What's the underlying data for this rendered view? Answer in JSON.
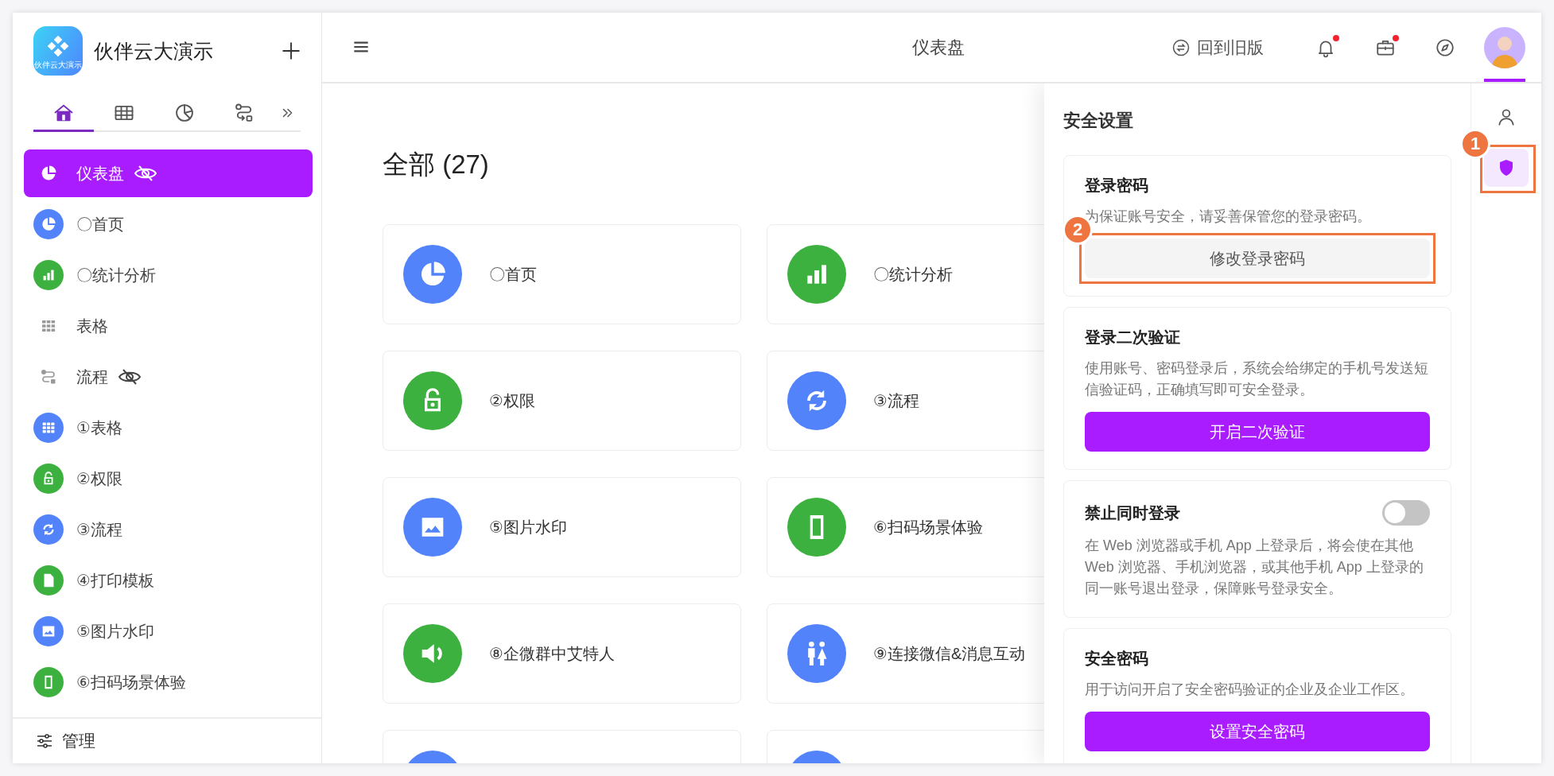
{
  "app": {
    "name": "伙伴云大演示",
    "logo_text": "伙伴云大演示"
  },
  "nav_tabs": [
    {
      "selected": true
    },
    {
      "selected": false
    },
    {
      "selected": false
    },
    {
      "selected": false
    },
    {
      "selected": false
    }
  ],
  "sidebar": {
    "items": [
      {
        "label": "仪表盘",
        "kind": "plain",
        "selected": true,
        "hidden": true
      },
      {
        "label": "〇首页",
        "kind": "app",
        "color": "#5283fb",
        "selected": false,
        "hidden": false
      },
      {
        "label": "〇统计分析",
        "kind": "app",
        "color": "#3db13f",
        "selected": false,
        "hidden": false
      },
      {
        "label": "表格",
        "kind": "plain",
        "selected": false,
        "hidden": false
      },
      {
        "label": "流程",
        "kind": "plain",
        "selected": false,
        "hidden": true
      },
      {
        "label": "①表格",
        "kind": "app",
        "color": "#5283fb",
        "selected": false,
        "hidden": false
      },
      {
        "label": "②权限",
        "kind": "app",
        "color": "#3db13f",
        "selected": false,
        "hidden": false
      },
      {
        "label": "③流程",
        "kind": "app",
        "color": "#5283fb",
        "selected": false,
        "hidden": false
      },
      {
        "label": "④打印模板",
        "kind": "app",
        "color": "#3db13f",
        "selected": false,
        "hidden": false
      },
      {
        "label": "⑤图片水印",
        "kind": "app",
        "color": "#5283fb",
        "selected": false,
        "hidden": false
      },
      {
        "label": "⑥扫码场景体验",
        "kind": "app",
        "color": "#3db13f",
        "selected": false,
        "hidden": false
      }
    ],
    "footer": "管理"
  },
  "header": {
    "title": "仪表盘",
    "back_link": "回到旧版",
    "actions": [
      {
        "dot": true
      },
      {
        "dot": true
      },
      {
        "dot": false
      }
    ],
    "avatar": {
      "selected": true
    }
  },
  "main": {
    "title": "全部 (27)",
    "cards": [
      {
        "label": "〇首页",
        "color": "#5283fb"
      },
      {
        "label": "〇统计分析",
        "color": "#3db13f"
      },
      {
        "label": "②权限",
        "color": "#3db13f"
      },
      {
        "label": "③流程",
        "color": "#5283fb"
      },
      {
        "label": "⑤图片水印",
        "color": "#5283fb"
      },
      {
        "label": "⑥扫码场景体验",
        "color": "#3db13f"
      },
      {
        "label": "⑧企微群中艾特人",
        "color": "#3db13f"
      },
      {
        "label": "⑨连接微信&消息互动",
        "color": "#5283fb"
      },
      {
        "color": "#5283fb"
      },
      {
        "color": "#5283fb"
      }
    ]
  },
  "security_panel": {
    "title": "安全设置",
    "sections": [
      {
        "kind": "button",
        "title": "登录密码",
        "description": "为保证账号安全，请妥善保管您的登录密码。",
        "button": {
          "label": "修改登录密码",
          "primary": false,
          "annotation": "2"
        }
      },
      {
        "kind": "button",
        "title": "登录二次验证",
        "description": "使用账号、密码登录后，系统会给绑定的手机号发送短信验证码，正确填写即可安全登录。",
        "button": {
          "label": "开启二次验证",
          "primary": true
        }
      },
      {
        "kind": "toggle",
        "title": "禁止同时登录",
        "on": false,
        "description": "在 Web 浏览器或手机 App 上登录后，将会使在其他 Web 浏览器、手机浏览器，或其他手机 App 上登录的同一账号退出登录，保障账号登录安全。"
      },
      {
        "kind": "button",
        "title": "安全密码",
        "description": "用于访问开启了安全密码验证的企业及企业工作区。",
        "button": {
          "label": "设置安全密码",
          "primary": true
        }
      }
    ]
  },
  "rail": [
    {
      "selected": false
    },
    {
      "selected": true,
      "annotation": "1"
    }
  ]
}
